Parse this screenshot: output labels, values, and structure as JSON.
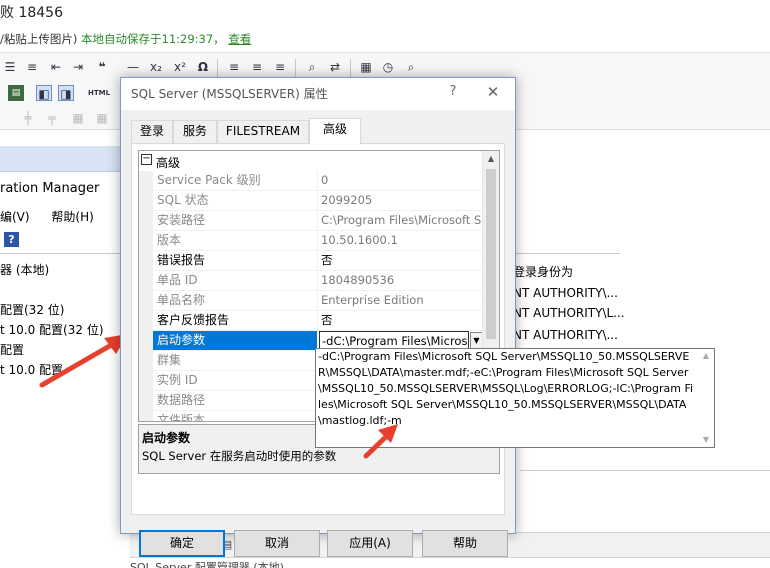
{
  "background": {
    "title": "败 18456",
    "hint_prefix": "/粘贴上传图片)",
    "autosave_text": "本地自动保存于11:29:37，",
    "view_link": "查看",
    "manager_title": "ration Manager",
    "menu": [
      "编(V)",
      "帮助(H)"
    ],
    "tree_items": [
      "器 (本地)",
      "配置(32 位)",
      "t 10.0 配置(32 位)",
      "配置",
      "t 10.0 配置"
    ],
    "column_header": "登录身份为",
    "accounts": [
      "NT AUTHORITY\\...",
      "NT AUTHORITY\\L...",
      "NT AUTHORITY\\..."
    ],
    "bottom_text": "SQL Server 配置管理器 (本地)"
  },
  "dialog": {
    "title": "SQL Server (MSSQLSERVER) 属性",
    "help_symbol": "?",
    "close_symbol": "✕",
    "tabs": [
      "登录",
      "服务",
      "FILESTREAM",
      "高级"
    ],
    "active_tab": "高级",
    "category": {
      "toggle": "−",
      "label": "高级"
    },
    "properties": [
      {
        "name": "Service Pack 级别",
        "value": "0",
        "editable": false
      },
      {
        "name": "SQL 状态",
        "value": "2099205",
        "editable": false
      },
      {
        "name": "安装路径",
        "value": "C:\\Program Files\\Microsoft SQL",
        "editable": false
      },
      {
        "name": "版本",
        "value": "10.50.1600.1",
        "editable": false
      },
      {
        "name": "错误报告",
        "value": "否",
        "editable": true
      },
      {
        "name": "单品 ID",
        "value": "1804890536",
        "editable": false
      },
      {
        "name": "单品名称",
        "value": "Enterprise Edition",
        "editable": false
      },
      {
        "name": "客户反馈报告",
        "value": "否",
        "editable": true
      },
      {
        "name": "启动参数",
        "value": "-dC:\\Program Files\\Microsoft",
        "editable": true,
        "selected": true
      },
      {
        "name": "群集",
        "value": "",
        "editable": false
      },
      {
        "name": "实例 ID",
        "value": "",
        "editable": false
      },
      {
        "name": "数据路径",
        "value": "",
        "editable": false
      },
      {
        "name": "文件版本",
        "value": "",
        "editable": false
      }
    ],
    "description": {
      "title": "启动参数",
      "text": "SQL Server 在服务启动时使用的参数"
    },
    "buttons": {
      "ok": "确定",
      "cancel": "取消",
      "apply": "应用(A)",
      "help": "帮助"
    },
    "startup_param_full": "-dC:\\Program Files\\Microsoft SQL Server\\MSSQL10_50.MSSQLSERVER\\MSSQL\\DATA\\master.mdf;-eC:\\Program Files\\Microsoft SQL Server\\MSSQL10_50.MSSQLSERVER\\MSSQL\\Log\\ERRORLOG;-lC:\\Program Files\\Microsoft SQL Server\\MSSQL10_50.MSSQLSERVER\\MSSQL\\DATA\\mastlog.ldf;-m"
  },
  "colors": {
    "selection": "#0078d7",
    "annotation_arrow": "#e8402e",
    "link_green": "#2a8a2a"
  }
}
